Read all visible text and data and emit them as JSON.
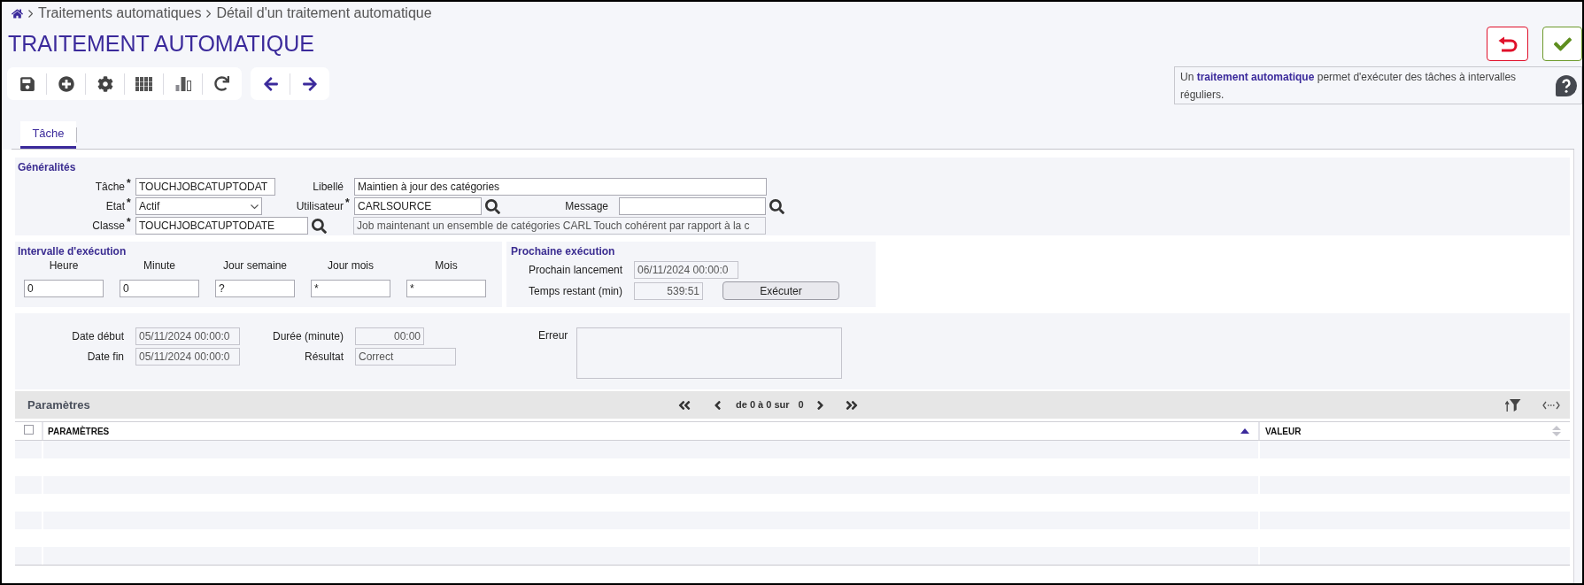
{
  "breadcrumb": [
    {
      "label": "Traitements automatiques"
    },
    {
      "label": "Détail d'un traitement automatique"
    }
  ],
  "title": "TRAITEMENT AUTOMATIQUE",
  "info": "Un **traitement automatique** permet d'exécuter des tâches à intervalles réguliers.",
  "tabs": [
    {
      "label": "Tâche",
      "selected": true
    }
  ],
  "general": {
    "title": "Généralités",
    "task": {
      "label": "Tâche",
      "mark": "*",
      "value": "TOUCHJOBCATUPTODAT",
      "readonly": false
    },
    "description": {
      "label": "Libellé",
      "value": "Maintien à jour des catégories",
      "readonly": false
    },
    "state": {
      "label": "Etat",
      "mark": "*",
      "value": "Actif"
    },
    "user": {
      "label": "Utilisateur",
      "mark": "*",
      "value": "CARLSOURCE",
      "readonly": false
    },
    "message": {
      "label": "Message",
      "readonly": false
    },
    "class": {
      "label": "Classe",
      "mark": "*",
      "value": "TOUCHJOBCATUPTODATE",
      "readonly": false
    },
    "class_comment": {
      "value": "Job maintenant un ensemble de catégories CARL Touch cohérent par rapport à la c",
      "readonly": true
    }
  },
  "interval": {
    "title": "Intervalle d'exécution",
    "fields": [
      {
        "label": "Heure",
        "value": "0",
        "readonly": false
      },
      {
        "label": "Minute",
        "value": "0",
        "readonly": false
      },
      {
        "label": "Jour semaine",
        "value": "?",
        "readonly": false
      },
      {
        "label": "Jour mois",
        "value": "*",
        "readonly": false
      },
      {
        "label": "Mois",
        "value": "*",
        "readonly": false
      }
    ]
  },
  "next_run": {
    "title": "Prochaine exécution",
    "next_launch": {
      "label": "Prochain lancement",
      "value": "06/11/2024 00:00:0",
      "readonly": true
    },
    "remaining": {
      "label": "Temps restant (min)",
      "value": "539:51",
      "readonly": true
    },
    "run_button": "Exécuter"
  },
  "result": {
    "start": {
      "label": "Date début",
      "value": "05/11/2024 00:00:0",
      "readonly": true
    },
    "end": {
      "label": "Date fin",
      "value": "05/11/2024 00:00:0",
      "readonly": true
    },
    "duration": {
      "label": "Durée (minute)",
      "value": "00:00",
      "readonly": true
    },
    "outcome": {
      "label": "Résultat",
      "value": "Correct",
      "readonly": true
    },
    "error": {
      "label": "Erreur",
      "readonly": true
    }
  },
  "parameters": {
    "title": "Paramètres",
    "pager": {
      "range": "de 0 à 0 sur",
      "total": "0"
    },
    "select_all": {
      "checked": false
    },
    "columns": [
      {
        "label": "PARAMÈTRES",
        "sorted": true
      },
      {
        "label": "VALEUR",
        "sorted": false
      }
    ]
  }
}
